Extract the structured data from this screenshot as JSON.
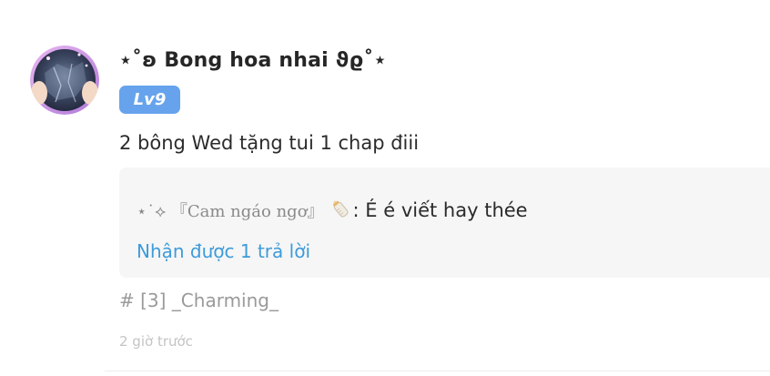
{
  "comment": {
    "username": "⋆˚ʚ Bong hoa nhai ϑϱ˚⋆",
    "level": "Lv9",
    "text": "2 bông Wed tặng tui 1 chap điii",
    "reply": {
      "author": "⋆˙⟡ 『Cam ngáo ngơ』",
      "icon": "baby-bottle-icon",
      "text": ": É é viết hay thée",
      "count_label": "Nhận được 1 trả lời"
    },
    "hashtag": "# [3] _Charming_",
    "timestamp": "2 giờ trước"
  },
  "colors": {
    "level_badge": "#66a3ec",
    "link": "#3d9bd9",
    "reply_background": "#f6f6f6",
    "muted_text": "#9a9a9a"
  }
}
